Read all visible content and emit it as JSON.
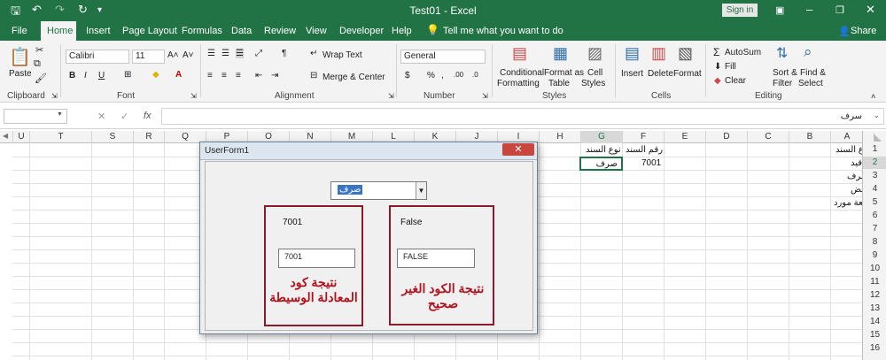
{
  "title_bar": {
    "title": "Test01 - Excel",
    "signin": "Sign in",
    "minimize": "–",
    "restore": "❐",
    "close": "✕",
    "ribbon_display": "▣"
  },
  "quick_access": {
    "save": "🖫",
    "undo": "↶",
    "redo": "↷",
    "refresh": "↻",
    "customize": "▾"
  },
  "tabs": [
    "File",
    "Home",
    "Insert",
    "Page Layout",
    "Formulas",
    "Data",
    "Review",
    "View",
    "Developer",
    "Help"
  ],
  "tell_me": "Tell me what you want to do",
  "share": "Share",
  "ribbon": {
    "clipboard": {
      "paste": "Paste",
      "group": "Clipboard"
    },
    "font": {
      "name": "Calibri",
      "size": "11",
      "bold": "B",
      "italic": "I",
      "underline": "U",
      "grow": "A˄",
      "shrink": "A˅",
      "group": "Font"
    },
    "alignment": {
      "wrap": "Wrap Text",
      "merge": "Merge & Center",
      "group": "Alignment"
    },
    "number": {
      "format": "General",
      "currency": "$",
      "percent": "%",
      "comma": ",",
      "inc": ".00",
      "dec": ".0",
      "group": "Number"
    },
    "styles": {
      "conditional": "Conditional",
      "conditional2": "Formatting",
      "format_as": "Format as",
      "format_as2": "Table",
      "cell": "Cell",
      "cell2": "Styles",
      "group": "Styles"
    },
    "cells": {
      "insert": "Insert",
      "delete": "Delete",
      "format": "Format",
      "group": "Cells"
    },
    "editing": {
      "autosum": "AutoSum",
      "fill": "Fill",
      "clear": "Clear",
      "sort": "Sort &",
      "sort2": "Filter",
      "find": "Find &",
      "find2": "Select",
      "group": "Editing"
    }
  },
  "formula_bar": {
    "name_box": "",
    "fx": "fx",
    "value": "سرف"
  },
  "columns": [
    "U",
    "T",
    "S",
    "R",
    "Q",
    "P",
    "O",
    "N",
    "M",
    "L",
    "K",
    "J",
    "I",
    "H",
    "G",
    "F",
    "E",
    "D",
    "C",
    "B",
    "A"
  ],
  "rows": [
    "1",
    "2",
    "3",
    "4",
    "5",
    "6",
    "7",
    "8",
    "9",
    "10",
    "11",
    "12",
    "13",
    "14",
    "15",
    "16"
  ],
  "cells": {
    "A1": "نوع السند",
    "A2": "قيد",
    "A3": "سرف",
    "A4": "قبض",
    "A5": "دفعة مورد",
    "F1": "رقم السند",
    "F2": "7001",
    "G1": "نوع السند",
    "G2": "صرف"
  },
  "userform": {
    "caption": "UserForm1",
    "close": "✕",
    "combo_value": "صرف",
    "left_label": "7001",
    "left_textbox": "7001",
    "left_caption": "نتيجة كود المعادلة الوسيطة",
    "right_label": "False",
    "right_textbox": "FALSE",
    "right_caption": "نتيجة الكود الغير صحيح"
  }
}
